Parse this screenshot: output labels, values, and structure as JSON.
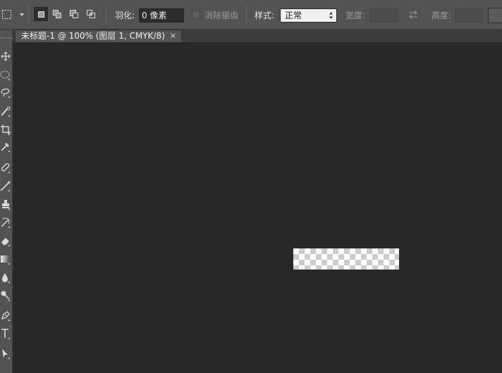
{
  "options_bar": {
    "tool_icon": "rect-marquee-icon",
    "selection_modes": [
      {
        "name": "new-selection",
        "active": true
      },
      {
        "name": "add-to-selection",
        "active": false
      },
      {
        "name": "subtract-from-selection",
        "active": false
      },
      {
        "name": "intersect-with-selection",
        "active": false
      }
    ],
    "feather_label": "羽化:",
    "feather_value": "0 像素",
    "antialias_label": "消除锯齿",
    "antialias_checked": false,
    "style_label": "样式:",
    "style_value": "正常",
    "width_label": "宽度:",
    "width_value": "",
    "height_label": "高度:",
    "height_value": ""
  },
  "document_tab": {
    "title": "未标题-1 @ 100% (图层 1, CMYK/8)",
    "close_glyph": "×"
  },
  "toolbar": {
    "tools": [
      "move-icon",
      "rect-marquee-icon",
      "lasso-icon",
      "quick-select-icon",
      "crop-icon",
      "eyedropper-icon",
      "healing-brush-icon",
      "brush-icon",
      "clone-stamp-icon",
      "history-brush-icon",
      "eraser-icon",
      "gradient-icon",
      "blur-icon",
      "dodge-icon",
      "pen-icon",
      "type-icon",
      "path-select-icon"
    ]
  },
  "colors": {
    "workspace_bg": "#282828",
    "panel_bg": "#535353",
    "checker_light": "#ffffff",
    "checker_dark": "#cccccc"
  }
}
